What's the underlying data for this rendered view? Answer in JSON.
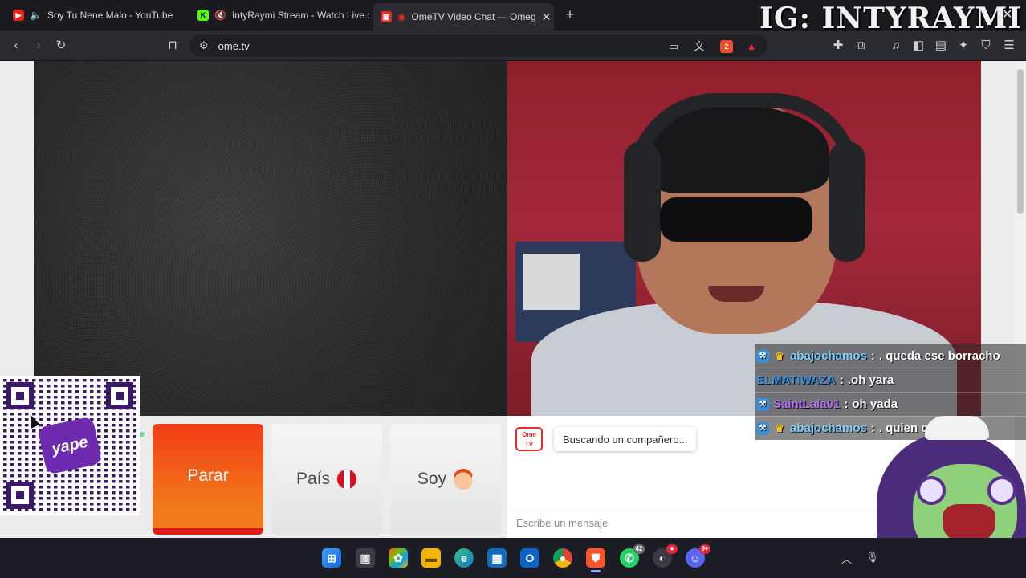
{
  "browser": {
    "tabs": [
      {
        "title": "Soy Tu Nene Malo - YouTube",
        "icon": "youtube-icon",
        "muted": true
      },
      {
        "title": "IntyRaymi Stream - Watch Live or",
        "icon": "kick-icon",
        "muted": true
      },
      {
        "title": "OmeTV Video Chat — Omeg",
        "icon": "ometv-icon",
        "active": true
      }
    ],
    "address": "ome.tv",
    "watermark": "IG: INTYRAYMI",
    "shield_count": "2"
  },
  "controls": {
    "stop_label": "Parar",
    "country_label": "País",
    "gender_label": "Soy",
    "country_flag": "peru-flag-icon",
    "gender_emoji": "boy-emoji-icon"
  },
  "qr": {
    "logo_text": "yape"
  },
  "chat": {
    "ome_logo_text": "Ome TV",
    "status": "Buscando un compañero...",
    "input_placeholder": "Escribe un mensaje"
  },
  "stream_chat": [
    {
      "user": "abajochamos",
      "user_color": "#7fd0ff",
      "sep": ":",
      "text": ". queda ese borracho"
    },
    {
      "user": "ELMATIWAZA",
      "user_color": "#3b8fe0",
      "sep": ":",
      "text": ".oh yara"
    },
    {
      "user": "SaintLala01",
      "user_color": "#b36cf0",
      "sep": ":",
      "text": "oh yada"
    },
    {
      "user": "abajochamos",
      "user_color": "#7fd0ff",
      "sep": ":",
      "text": ". quien c         ra nico"
    }
  ],
  "taskbar": {
    "whatsapp_badge": "42",
    "discord_badge": "9+"
  },
  "colors": {
    "stop_button": "#f23c17",
    "ometv_red": "#e52d27",
    "taskbar_bg": "#1c1d24"
  }
}
